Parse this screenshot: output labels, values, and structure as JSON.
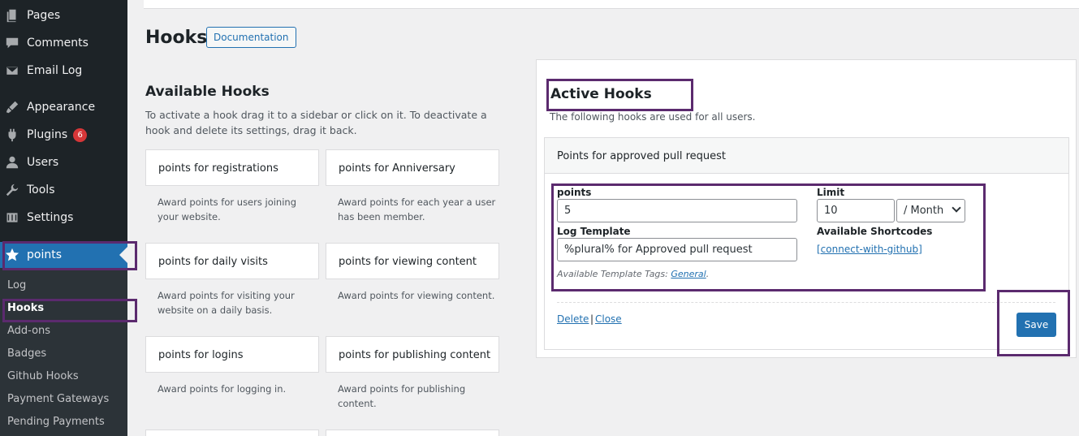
{
  "sidebar": {
    "items": [
      {
        "label": "Pages",
        "icon": "pages-icon"
      },
      {
        "label": "Comments",
        "icon": "comments-icon"
      },
      {
        "label": "Email Log",
        "icon": "email-icon"
      },
      {
        "label": "Appearance",
        "icon": "appearance-icon"
      },
      {
        "label": "Plugins",
        "icon": "plugins-icon",
        "badge": "6"
      },
      {
        "label": "Users",
        "icon": "users-icon"
      },
      {
        "label": "Tools",
        "icon": "tools-icon"
      },
      {
        "label": "Settings",
        "icon": "settings-icon"
      }
    ],
    "active": {
      "label": "points",
      "icon": "star-icon"
    },
    "submenu": [
      "Log",
      "Hooks",
      "Add-ons",
      "Badges",
      "Github Hooks",
      "Payment Gateways",
      "Pending Payments"
    ],
    "current_submenu": "Hooks"
  },
  "header": {
    "title": "Hooks",
    "doc_button": "Documentation"
  },
  "available": {
    "title": "Available Hooks",
    "description": "To activate a hook drag it to a sidebar or click on it. To deactivate a hook and delete its settings, drag it back.",
    "hooks": [
      {
        "name": "points for registrations",
        "desc": "Award points for users joining your website."
      },
      {
        "name": "points for Anniversary",
        "desc": "Award points for each year a user has been member."
      },
      {
        "name": "points for daily visits",
        "desc": "Award points for visiting your website on a daily basis."
      },
      {
        "name": "points for viewing content",
        "desc": "Award points for viewing content."
      },
      {
        "name": "points for logins",
        "desc": "Award points for logging in."
      },
      {
        "name": "points for publishing content",
        "desc": "Award points for publishing content."
      }
    ]
  },
  "active": {
    "title": "Active Hooks",
    "description": "The following hooks are used for all users.",
    "card": {
      "title": "Points for approved pull request",
      "points_label": "points",
      "points_value": "5",
      "limit_label": "Limit",
      "limit_value": "10",
      "limit_period": "/ Month",
      "log_template_label": "Log Template",
      "log_template_value": "%plural% for Approved pull request",
      "shortcodes_label": "Available Shortcodes",
      "shortcode": "[connect-with-github]",
      "template_tags_label": "Available Template Tags:",
      "template_tags_link": "General",
      "template_tags_suffix": ".",
      "delete_label": "Delete",
      "separator": "|",
      "close_label": "Close",
      "save_label": "Save"
    }
  },
  "colors": {
    "accent": "#2271b1",
    "sidebar_bg": "#1d2327",
    "highlight": "#5b2a6e",
    "badge": "#d63638"
  }
}
